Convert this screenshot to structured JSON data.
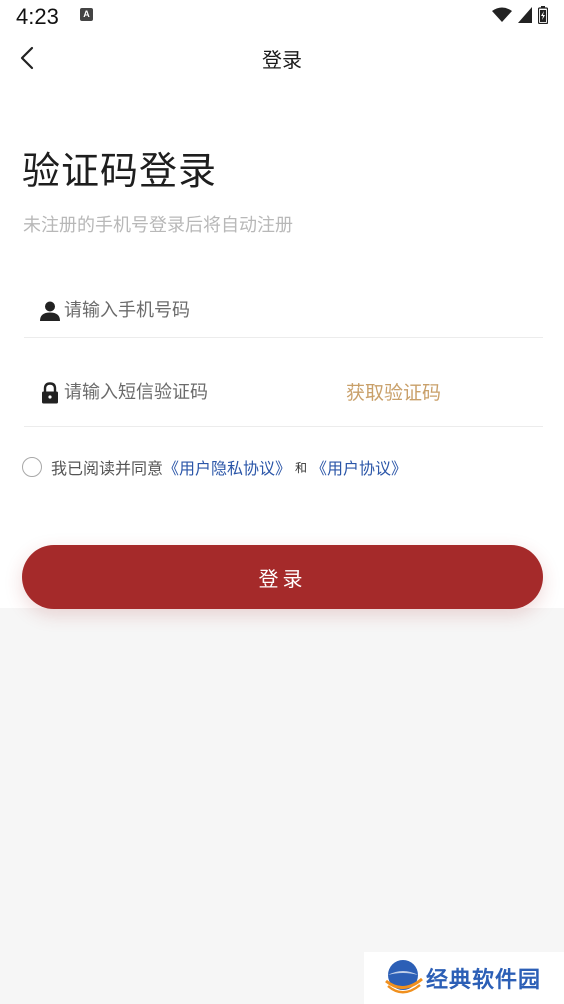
{
  "status_bar": {
    "time": "4:23",
    "a_badge": "A",
    "icons": [
      "wifi-icon",
      "signal-icon",
      "battery-icon"
    ]
  },
  "nav": {
    "title": "登录",
    "back_icon": "chevron-left-icon"
  },
  "header": {
    "title": "验证码登录",
    "subtitle": "未注册的手机号登录后将自动注册"
  },
  "form": {
    "phone": {
      "icon": "user-icon",
      "placeholder": "请输入手机号码",
      "value": ""
    },
    "code": {
      "icon": "lock-icon",
      "placeholder": "请输入短信验证码",
      "value": "",
      "get_code_label": "获取验证码"
    }
  },
  "agreement": {
    "checked": false,
    "prefix": "我已阅读并同意",
    "privacy_link": "《用户隐私协议》",
    "and": "和",
    "user_link": "《用户协议》"
  },
  "login_button": {
    "label": "登录"
  },
  "watermark": {
    "text": "经典软件园"
  },
  "colors": {
    "primary": "#a52a2a",
    "accent_gold": "#c9a06a",
    "link_blue": "#2b56a8",
    "background": "#f6f6f6"
  }
}
